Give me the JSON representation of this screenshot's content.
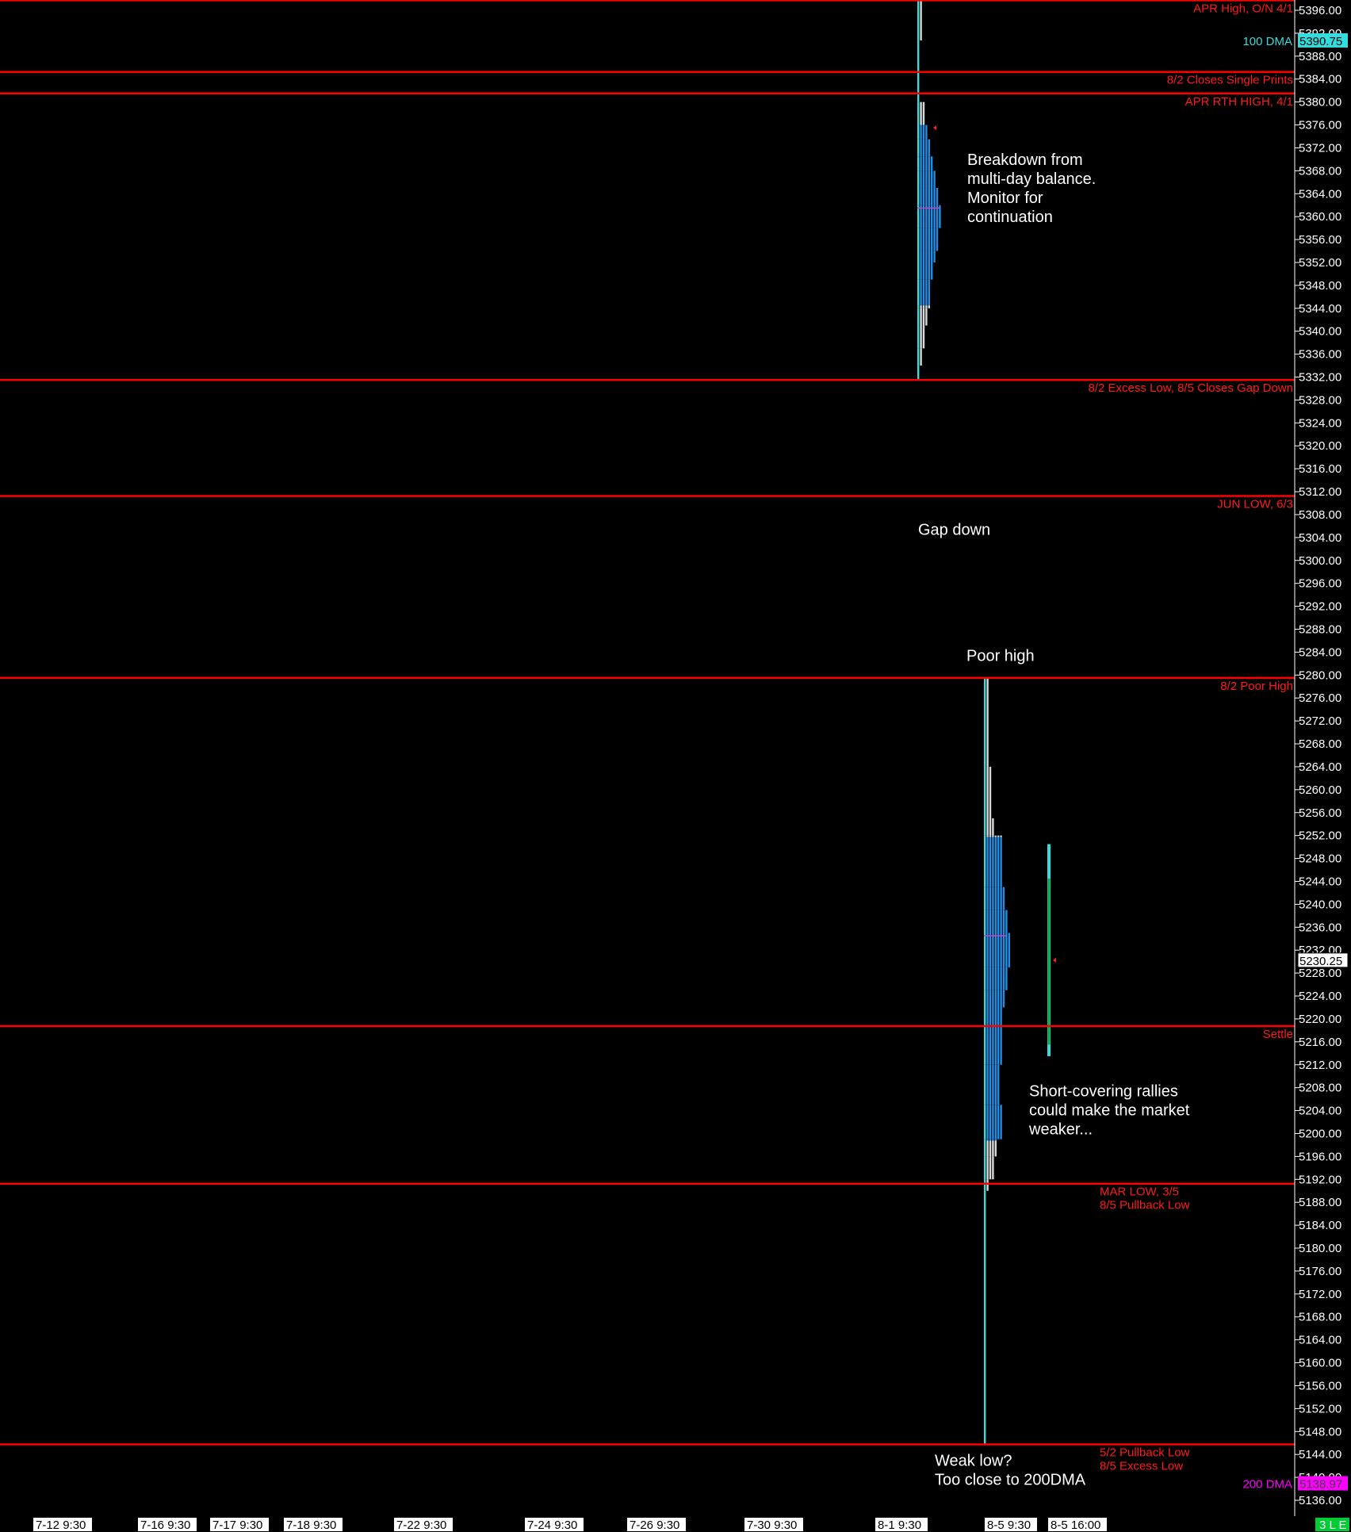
{
  "colors": {
    "background": "#000000",
    "level_line": "#ff0000",
    "level_text": "#ff1a1a",
    "profile_value_area": "#1e8fe6",
    "profile_outside": "#d9d9d9",
    "profile_poc": "#cc44cc",
    "axis_text": "#ffffff",
    "dma100": "#33dddd",
    "dma200": "#ff00ff",
    "bottom_tag": "#00cc33"
  },
  "chart_data": {
    "type": "market-profile",
    "ylim": [
      5134,
      5398
    ],
    "y_ticks": [
      5396,
      5392,
      5388,
      5384,
      5380,
      5376,
      5372,
      5368,
      5364,
      5360,
      5356,
      5352,
      5348,
      5344,
      5340,
      5336,
      5332,
      5328,
      5324,
      5320,
      5316,
      5312,
      5308,
      5304,
      5300,
      5296,
      5292,
      5288,
      5284,
      5280,
      5276,
      5272,
      5268,
      5264,
      5260,
      5256,
      5252,
      5248,
      5244,
      5240,
      5236,
      5232,
      5228,
      5224,
      5220,
      5216,
      5212,
      5208,
      5204,
      5200,
      5196,
      5192,
      5188,
      5184,
      5180,
      5176,
      5172,
      5168,
      5164,
      5160,
      5156,
      5152,
      5148,
      5144,
      5140,
      5136
    ],
    "y_tick_labels": [
      "5396.00",
      "5392.00",
      "5388.00",
      "5384.00",
      "5380.00",
      "5376.00",
      "5372.00",
      "5368.00",
      "5364.00",
      "5360.00",
      "5356.00",
      "5352.00",
      "5348.00",
      "5344.00",
      "5340.00",
      "5336.00",
      "5332.00",
      "5328.00",
      "5324.00",
      "5320.00",
      "5316.00",
      "5312.00",
      "5308.00",
      "5304.00",
      "5300.00",
      "5296.00",
      "5292.00",
      "5288.00",
      "5284.00",
      "5280.00",
      "5276.00",
      "5272.00",
      "5268.00",
      "5264.00",
      "5260.00",
      "5256.00",
      "5252.00",
      "5248.00",
      "5244.00",
      "5240.00",
      "5236.00",
      "5232.00",
      "5228.00",
      "5224.00",
      "5220.00",
      "5216.00",
      "5212.00",
      "5208.00",
      "5204.00",
      "5200.00",
      "5196.00",
      "5192.00",
      "5188.00",
      "5184.00",
      "5180.00",
      "5176.00",
      "5172.00",
      "5168.00",
      "5164.00",
      "5160.00",
      "5156.00",
      "5152.00",
      "5148.00",
      "5144.00",
      "5140.00",
      "5136.00"
    ],
    "levels": [
      {
        "price": 5397.75,
        "label": "APR High, O/N 4/1"
      },
      {
        "price": 5385.25,
        "label": "8/2 Closes Single Prints"
      },
      {
        "price": 5381.5,
        "label": "APR RTH HIGH, 4/1"
      },
      {
        "price": 5331.5,
        "label": "8/2 Excess Low, 8/5 Closes Gap Down"
      },
      {
        "price": 5311.25,
        "label": "JUN LOW, 6/3"
      },
      {
        "price": 5279.5,
        "label": "8/2 Poor High"
      },
      {
        "price": 5218.75,
        "label": "Settle"
      },
      {
        "price": 5191.25,
        "label": "MAR LOW, 3/5",
        "label2": "8/5 Pullback Low"
      },
      {
        "price": 5145.75,
        "label": "5/2 Pullback Low",
        "label2": "8/5 Excess Low"
      }
    ],
    "price_tags": [
      {
        "name": "100 DMA",
        "value": "5390.75",
        "price": 5390.75,
        "color": "#33dddd"
      },
      {
        "name": "",
        "value": "5230.25",
        "price": 5230.25,
        "color": "#ffffff"
      },
      {
        "name": "200 DMA",
        "value": "5138.97",
        "price": 5138.97,
        "color": "#ff00ff"
      }
    ],
    "profiles": [
      {
        "day": "8-1",
        "high": 5397.75,
        "low": 5331.5,
        "poc": 5361.5,
        "value_area": [
          5344.5,
          5376
        ],
        "rows": [
          [
            5397.75,
            5390.75,
            2
          ],
          [
            5390.75,
            5380,
            1
          ],
          [
            5380,
            5376,
            3
          ],
          [
            5376,
            5373.5,
            4
          ],
          [
            5373.5,
            5370.5,
            5
          ],
          [
            5370.5,
            5368,
            6
          ],
          [
            5368,
            5365,
            7
          ],
          [
            5365,
            5362,
            8
          ],
          [
            5362,
            5358,
            9
          ],
          [
            5358,
            5354,
            8
          ],
          [
            5354,
            5352,
            7
          ],
          [
            5352,
            5349,
            6
          ],
          [
            5349,
            5344,
            5
          ],
          [
            5344,
            5341,
            4
          ],
          [
            5341,
            5337,
            3
          ],
          [
            5337,
            5334,
            2
          ],
          [
            5334,
            5331.5,
            1
          ]
        ]
      },
      {
        "day": "8-5",
        "high": 5279.5,
        "low": 5145.75,
        "poc": 5234.5,
        "value_area": [
          5198.75,
          5251.75
        ],
        "rows": [
          [
            5279.5,
            5264,
            2
          ],
          [
            5264,
            5255,
            3
          ],
          [
            5255,
            5252,
            4
          ],
          [
            5252,
            5243,
            7
          ],
          [
            5243,
            5239,
            8
          ],
          [
            5239,
            5235,
            9
          ],
          [
            5235,
            5229,
            10
          ],
          [
            5229,
            5225,
            9
          ],
          [
            5225,
            5222,
            8
          ],
          [
            5222,
            5212,
            7
          ],
          [
            5212,
            5205,
            6
          ],
          [
            5205,
            5199,
            7
          ],
          [
            5199,
            5196,
            5
          ],
          [
            5196,
            5192,
            4
          ],
          [
            5192,
            5190,
            2
          ],
          [
            5190,
            5145.75,
            1
          ]
        ]
      }
    ],
    "current_day": {
      "day": "8-5 16:00",
      "high": 5250.5,
      "low": 5213.5,
      "open": 5244.5,
      "close": 5230.25,
      "last": 5230.25
    },
    "annotations": [
      {
        "lines": [
          "Breakdown from",
          "multi-day balance.",
          "Monitor for",
          "continuation"
        ],
        "price": 5369
      },
      {
        "lines": [
          "Gap down"
        ],
        "price": 5304.5
      },
      {
        "lines": [
          "Poor high"
        ],
        "price": 5282.5
      },
      {
        "lines": [
          "Short-covering rallies",
          "could make the market",
          "weaker..."
        ],
        "price": 5206.5
      },
      {
        "lines": [
          "Weak low?",
          "Too close to 200DMA"
        ],
        "price": 5142
      }
    ],
    "x_labels": [
      "7-12  9:30",
      "7-16  9:30",
      "7-17  9:30",
      "7-18  9:30",
      "7-22  9:30",
      "7-24  9:30",
      "7-26  9:30",
      "7-30  9:30",
      "8-1  9:30",
      "8-5  9:30",
      "8-5  16:00"
    ],
    "corner_tag": "3 L E"
  }
}
